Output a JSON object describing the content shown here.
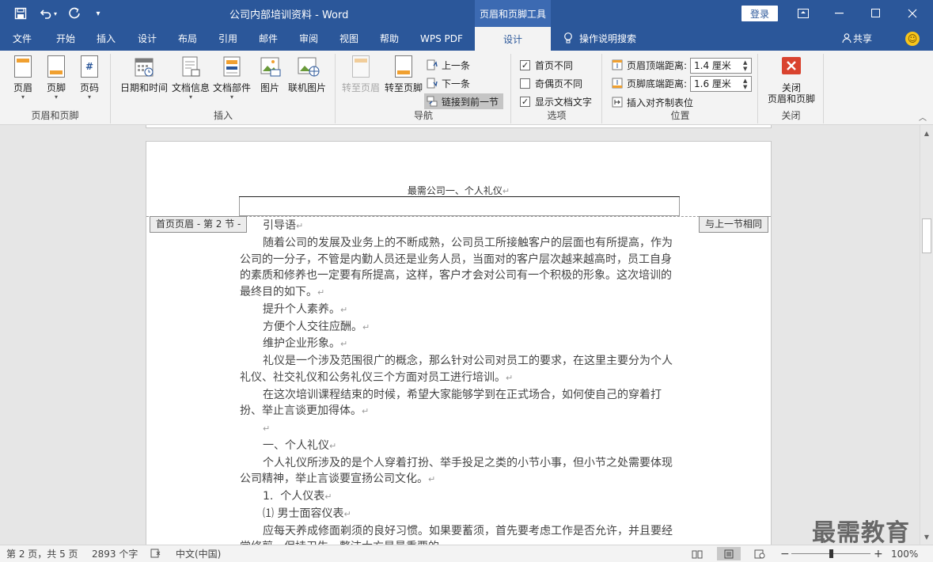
{
  "titlebar": {
    "doc_title": "公司内部培训资料  -  Word",
    "context_tab": "页眉和页脚工具",
    "login": "登录"
  },
  "menu": {
    "items": [
      "文件",
      "开始",
      "插入",
      "设计",
      "布局",
      "引用",
      "邮件",
      "审阅",
      "视图",
      "帮助",
      "WPS PDF"
    ],
    "active_tab": "设计",
    "tellme": "操作说明搜索",
    "share": "共享"
  },
  "ribbon": {
    "hf": {
      "header": "页眉",
      "footer": "页脚",
      "pagenum": "页码",
      "label": "页眉和页脚"
    },
    "insert": {
      "datetime": "日期和时间",
      "docinfo": "文档信息",
      "parts": "文档部件",
      "picture": "图片",
      "online_picture": "联机图片",
      "label": "插入"
    },
    "nav": {
      "goto_header": "转至页眉",
      "goto_footer": "转至页脚",
      "prev": "上一条",
      "next": "下一条",
      "link_prev": "链接到前一节",
      "label": "导航"
    },
    "options": {
      "diff_first": "首页不同",
      "diff_odd_even": "奇偶页不同",
      "show_text": "显示文档文字",
      "label": "选项",
      "diff_first_checked": true,
      "diff_odd_even_checked": false,
      "show_text_checked": true
    },
    "position": {
      "header_top": "页眉顶端距离:",
      "header_top_value": "1.4 厘米",
      "footer_bottom": "页脚底端距离:",
      "footer_bottom_value": "1.6 厘米",
      "insert_align_tab": "插入对齐制表位",
      "label": "位置"
    },
    "close": {
      "btn": "关闭\n页眉和页脚",
      "label": "关闭"
    }
  },
  "document": {
    "header_text": "最需公司一、个人礼仪",
    "header_tag_left": "首页页眉 - 第 2 节 -",
    "header_tag_right": "与上一节相同",
    "paragraphs": [
      "引导语",
      "随着公司的发展及业务上的不断成熟，公司员工所接触客户的层面也有所提高，作为公司的一分子，不管是内勤人员还是业务人员，当面对的客户层次越来越高时，员工自身的素质和修养也一定要有所提高，这样，客户才会对公司有一个积极的形象。这次培训的最终目的如下。",
      "提升个人素养。",
      "方便个人交往应酬。",
      "维护企业形象。",
      "礼仪是一个涉及范围很广的概念，那么针对公司对员工的要求，在这里主要分为个人礼仪、社交礼仪和公务礼仪三个方面对员工进行培训。",
      "在这次培训课程结束的时候，希望大家能够学到在正式场合，如何使自己的穿着打扮、举止言谈更加得体。",
      "",
      "一、个人礼仪",
      "个人礼仪所涉及的是个人穿着打扮、举手投足之类的小节小事，但小节之处需要体现公司精神，举止言谈要宣扬公司文化。",
      "1.  个人仪表",
      "⑴ 男士面容仪表",
      "应每天养成修面剃须的良好习惯。如果要蓄须，首先要考虑工作是否允许，并且要经常修剪，保持卫生，整洁大方是最重要的。"
    ]
  },
  "status": {
    "page": "第 2 页，共 5 页",
    "words": "2893 个字",
    "lang": "中文(中国)",
    "zoom": "100%"
  },
  "watermark": "最需教育",
  "colors": {
    "brand": "#2b579a",
    "context_tab": "#3c6ab2",
    "ribbon_bg": "#f3f3f3",
    "close_red": "#d9432f"
  }
}
